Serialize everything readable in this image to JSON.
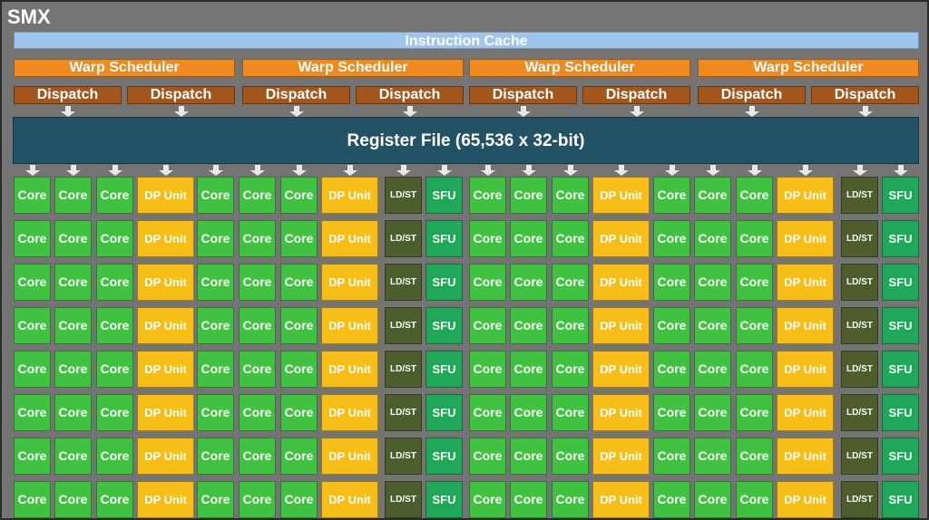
{
  "title": "SMX",
  "instruction_cache": "Instruction Cache",
  "warp_scheduler_label": "Warp Scheduler",
  "dispatch_label": "Dispatch",
  "register_file": "Register File (65,536 x 32-bit)",
  "unit_labels": {
    "core": "Core",
    "dp": "DP Unit",
    "ldst": "LD/ST",
    "sfu": "SFU"
  },
  "row_pattern": [
    "core",
    "core",
    "core",
    "dp",
    "core",
    "core",
    "core",
    "dp",
    "ldst",
    "sfu",
    "core",
    "core",
    "core",
    "dp",
    "core",
    "core",
    "core",
    "dp",
    "ldst",
    "sfu"
  ],
  "row_count": 8,
  "colors": {
    "core": "#3fc23f",
    "dp": "#f6be17",
    "ldst": "#4e5d2c",
    "sfu": "#1ea857",
    "register_file": "#215266",
    "warp": "#ef8a1e",
    "dispatch": "#a2561c",
    "icache": "#9ec6ec"
  }
}
